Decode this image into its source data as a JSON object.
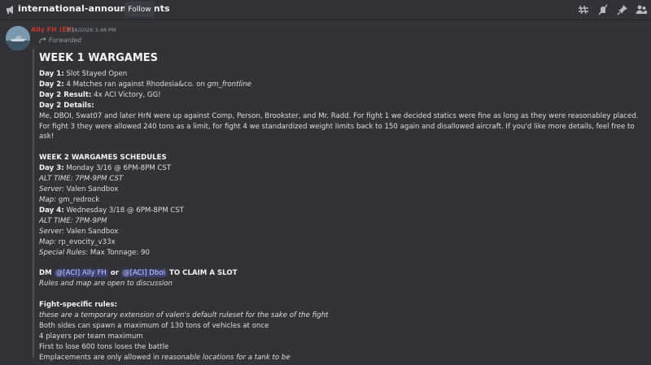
{
  "header": {
    "channel_name": "international-announcements",
    "follow_label": "Follow",
    "icons": [
      "threads-icon",
      "mute-icon",
      "pin-icon",
      "member-list-icon"
    ]
  },
  "message": {
    "author": "Ally FH (EP)",
    "timestamp": "3/16/2026 3:48 PM",
    "forwarded_label": "Forwarded",
    "title": "WEEK 1 WARGAMES",
    "day1_label": "Day 1:",
    "day1_value": " Slot Stayed Open",
    "day2_label": "Day 2:",
    "day2_value": " 4 Matches ran against Rhodesia&co. on ",
    "day2_map": "gm_frontline",
    "day2_result_label": "Day 2 Result:",
    "day2_result_value": " 4x ACI Victory, GG!",
    "day2_details_label": "Day 2 Details:",
    "day2_details_text": "Me, DBOI, Swat07 and later HrN were up against Comp, Person, Brookster, and Mr. Radd. For fight 1 we decided statics were fine as long as they were reasonabley placed. For fight 3 they were allowed 240 tons as a limit, for fight 4 we standardized weight limits back to 150 again and disallowed aircraft. If you'd like more details, feel free to ask!",
    "week2_heading": "WEEK 2 WARGAMES SCHEDULES",
    "day3_label": "Day 3:",
    "day3_value": " Monday 3/16 @ 6PM-8PM CST",
    "day3_alt": "ALT TIME: 7PM-9PM CST",
    "day3_server_label": "Server:",
    "day3_server_value": " Valen Sandbox",
    "day3_map_label": "Map:",
    "day3_map_value": " gm_redrock",
    "day4_label": "Day 4:",
    "day4_value": " Wednesday 3/18 @ 6PM-8PM CST",
    "day4_alt": "ALT TIME: 7PM-9PM",
    "day4_server_label": "Server:",
    "day4_server_value": " Valen Sandbox",
    "day4_map_label": "Map:",
    "day4_map_value": " rp_evocity_v33x",
    "day4_rules_label": "Special Rules:",
    "day4_rules_value": " Max Tonnage: 90",
    "dm_prefix": "DM ",
    "mention1": "@[ACI] Ally FH",
    "dm_or": " or ",
    "mention2": "@[ACI] Dboi",
    "dm_suffix": " TO CLAIM A SLOT",
    "rules_open": "Rules and map are open to discussion",
    "fight_rules_heading": "Fight-specific rules:",
    "fight_rules_note": "these are a temporary extension of valen's default ruleset for the sake of the fight",
    "rule1": "Both sides can spawn a maximum of 130 tons of vehicles at once",
    "rule2": "4 players per team maximum",
    "rule3": "First to lose 600 tons loses the battle",
    "rule4_prefix": "Emplacements are only allowed in ",
    "rule4_italic": "reasonable locations for a tank to be"
  },
  "colors": {
    "background": "#313338",
    "text": "#dbdee1",
    "author": "#c0392b",
    "mention_bg": "#3c4270",
    "mention_text": "#c9cdfb"
  }
}
